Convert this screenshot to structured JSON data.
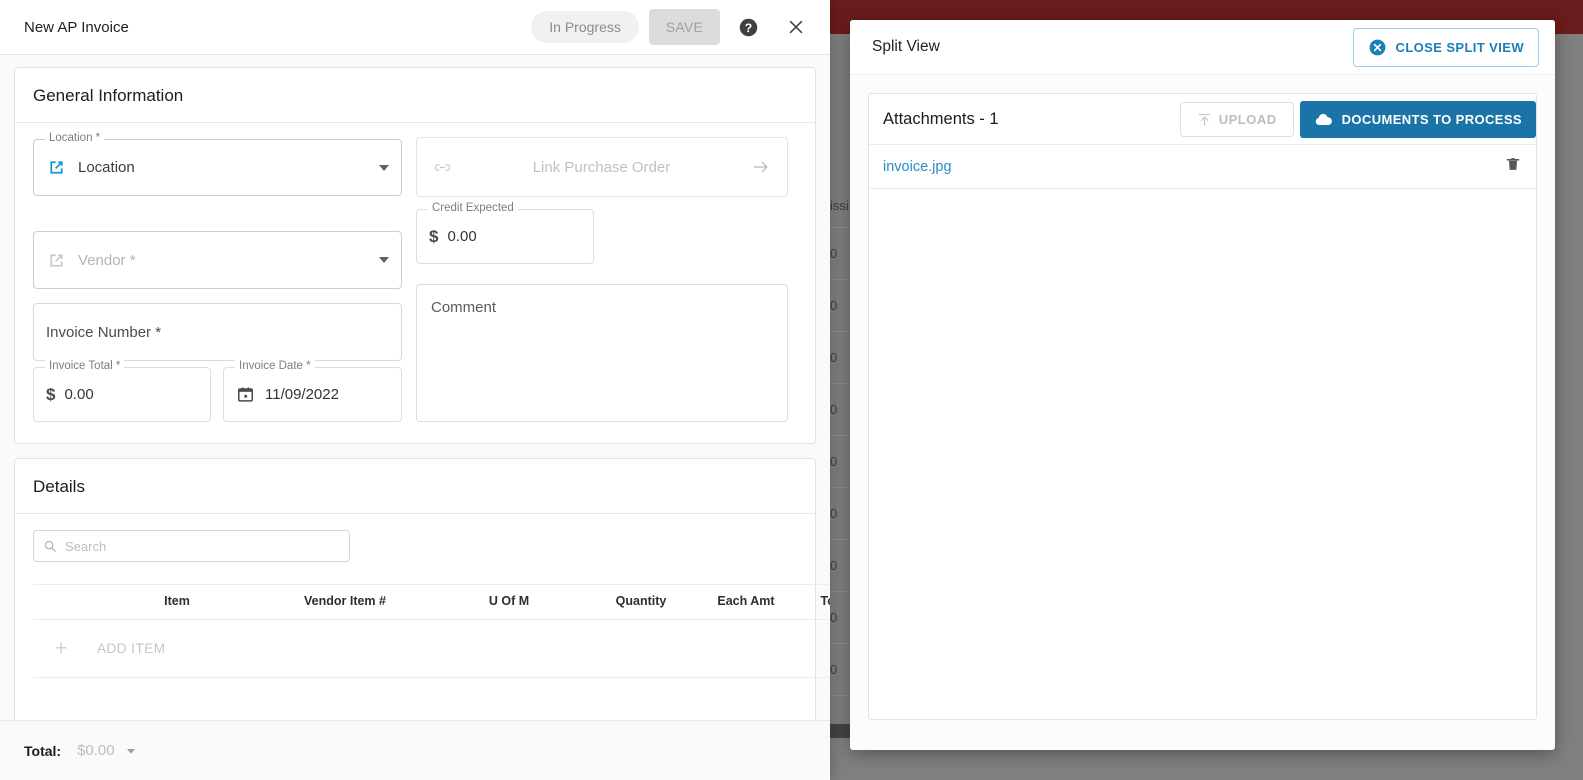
{
  "background": {
    "app_bar_color": "#6b1c1c",
    "overlay_color": "#808080",
    "table_header_fragment": "issi",
    "table_cell_fragment": "0",
    "row_count": 9
  },
  "invoice_dialog": {
    "title": "New AP Invoice",
    "status_pill": "In Progress",
    "save_label": "SAVE",
    "help_icon": "help-circle-icon",
    "close_icon": "close-icon",
    "general": {
      "heading": "General Information",
      "location": {
        "label": "Location *",
        "value": "Location",
        "icon": "open-in-new-icon",
        "icon_color": "#0e9bd8"
      },
      "purchase_order": {
        "placeholder": "Link Purchase Order",
        "icon": "link-icon",
        "arrow_icon": "arrow-right-icon"
      },
      "vendor": {
        "placeholder": "Vendor *",
        "icon": "open-in-new-icon"
      },
      "credit_expected": {
        "label": "Credit Expected",
        "currency": "$",
        "value": "0.00"
      },
      "invoice_number": {
        "placeholder": "Invoice Number *"
      },
      "invoice_total": {
        "label": "Invoice Total *",
        "currency": "$",
        "value": "0.00"
      },
      "invoice_date": {
        "label": "Invoice Date *",
        "value": "11/09/2022",
        "icon": "calendar-icon"
      },
      "comment": {
        "placeholder": "Comment"
      }
    },
    "details": {
      "heading": "Details",
      "search_placeholder": "Search",
      "search_value": "",
      "search_icon": "search-icon",
      "columns": [
        "",
        "Item",
        "Vendor Item #",
        "U Of M",
        "Quantity",
        "Each Amt",
        "Total"
      ],
      "add_item_label": "ADD ITEM",
      "add_item_icon": "plus-icon",
      "rows": []
    },
    "footer": {
      "total_label": "Total:",
      "total_value": "$0.00",
      "expand_icon": "caret-down-icon"
    }
  },
  "split_view": {
    "title": "Split View",
    "close_button": {
      "label": "CLOSE SPLIT VIEW",
      "icon": "close-circle-icon",
      "color": "#1b7fba"
    },
    "attachments": {
      "title": "Attachments - 1",
      "upload_label": "UPLOAD",
      "upload_icon": "upload-icon",
      "documents_label": "DOCUMENTS TO PROCESS",
      "documents_icon": "cloud-icon",
      "documents_color": "#1a74a8",
      "files": [
        {
          "name": "invoice.jpg",
          "delete_icon": "trash-icon"
        }
      ]
    }
  }
}
